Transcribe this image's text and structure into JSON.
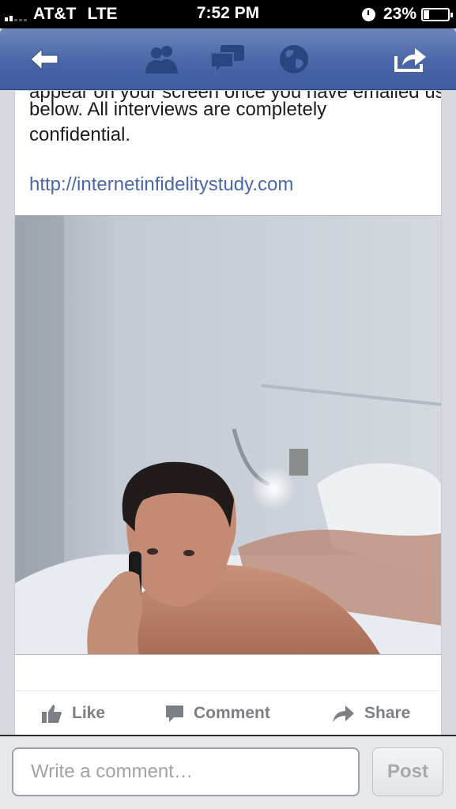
{
  "status_bar": {
    "carrier": "AT&T",
    "network": "LTE",
    "time": "7:52 PM",
    "battery": "23%",
    "battery_level": 0.23
  },
  "nav": {
    "icons": [
      "back-arrow-icon",
      "friends-icon",
      "messages-icon",
      "globe-icon",
      "share-icon"
    ]
  },
  "post": {
    "partial_line": "appear on your screen once you have emailed us",
    "body_lines": [
      "below. All interviews are completely",
      "confidential."
    ],
    "link": "http://internetinfidelitystudy.com"
  },
  "actions": {
    "like": "Like",
    "comment": "Comment",
    "share": "Share"
  },
  "comment_bar": {
    "placeholder": "Write a comment…",
    "post_label": "Post"
  },
  "colors": {
    "nav_blue": "#4a66a6",
    "link": "#4a67a8",
    "action_gray": "#7b7f86"
  }
}
